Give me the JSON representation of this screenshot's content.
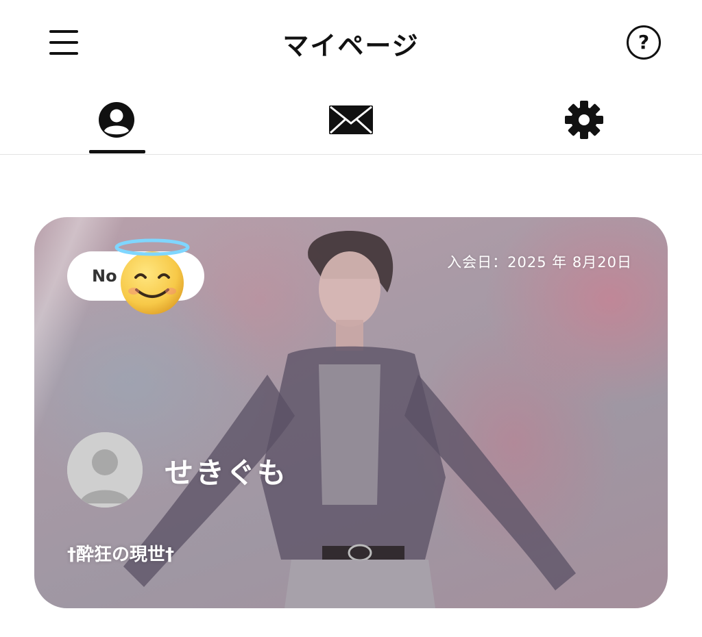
{
  "header": {
    "title": "マイページ",
    "menu_icon": "hamburger-menu-icon",
    "help_label": "?"
  },
  "tabs": [
    {
      "name": "profile",
      "icon": "user-circle-icon",
      "active": true
    },
    {
      "name": "messages",
      "icon": "envelope-icon",
      "active": false
    },
    {
      "name": "settings",
      "icon": "gear-icon",
      "active": false
    }
  ],
  "card": {
    "member_no_label": "No",
    "sticker": "smiling-face-with-halo-emoji",
    "join_date": "入会日：2025 年 8月20日",
    "user_name": "せきぐも",
    "user_title": "†酔狂の現世†",
    "avatar_icon": "default-avatar-icon"
  },
  "colors": {
    "text": "#111111",
    "card_text": "#ffffff",
    "divider": "#e3e3e3"
  }
}
